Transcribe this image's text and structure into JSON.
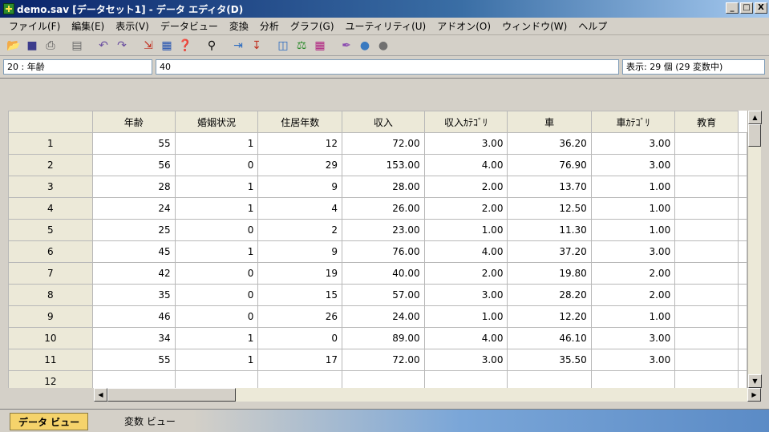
{
  "window": {
    "title": "demo.sav [データセット1] - データ エディタ(D)",
    "controls": [
      "_",
      "□",
      "X"
    ]
  },
  "menu": [
    "ファイル(F)",
    "編集(E)",
    "表示(V)",
    "データビュー",
    "変換",
    "分析",
    "グラフ(G)",
    "ユーティリティ(U)",
    "アドオン(O)",
    "ウィンドウ(W)",
    "ヘルプ"
  ],
  "toolbar_icons": [
    "open-icon",
    "save-icon",
    "print-icon",
    "dialog-recall-icon",
    "undo-icon",
    "redo-icon",
    "goto-case-icon",
    "goto-variable-icon",
    "variables-icon",
    "find-icon",
    "insert-cases-icon",
    "insert-variable-icon",
    "split-file-icon",
    "weight-cases-icon",
    "select-cases-icon",
    "value-labels-icon",
    "use-sets-icon",
    "show-all-icon"
  ],
  "cellbar": {
    "cell_ref": "20 : 年齢",
    "value": "40",
    "visible_info": "表示: 29 個 (29 変数中)"
  },
  "grid": {
    "columns": [
      "年齢",
      "婚姻状況",
      "住居年数",
      "収入",
      "収入ｶﾃｺﾞﾘ",
      "車",
      "車ｶﾃｺﾞﾘ",
      "教育"
    ],
    "rows": [
      {
        "num": "1",
        "cells": [
          "55",
          "1",
          "12",
          "72.00",
          "3.00",
          "36.20",
          "3.00",
          ""
        ]
      },
      {
        "num": "2",
        "cells": [
          "56",
          "0",
          "29",
          "153.00",
          "4.00",
          "76.90",
          "3.00",
          ""
        ]
      },
      {
        "num": "3",
        "cells": [
          "28",
          "1",
          "9",
          "28.00",
          "2.00",
          "13.70",
          "1.00",
          ""
        ]
      },
      {
        "num": "4",
        "cells": [
          "24",
          "1",
          "4",
          "26.00",
          "2.00",
          "12.50",
          "1.00",
          ""
        ]
      },
      {
        "num": "5",
        "cells": [
          "25",
          "0",
          "2",
          "23.00",
          "1.00",
          "11.30",
          "1.00",
          ""
        ]
      },
      {
        "num": "6",
        "cells": [
          "45",
          "1",
          "9",
          "76.00",
          "4.00",
          "37.20",
          "3.00",
          ""
        ]
      },
      {
        "num": "7",
        "cells": [
          "42",
          "0",
          "19",
          "40.00",
          "2.00",
          "19.80",
          "2.00",
          ""
        ]
      },
      {
        "num": "8",
        "cells": [
          "35",
          "0",
          "15",
          "57.00",
          "3.00",
          "28.20",
          "2.00",
          ""
        ]
      },
      {
        "num": "9",
        "cells": [
          "46",
          "0",
          "26",
          "24.00",
          "1.00",
          "12.20",
          "1.00",
          ""
        ]
      },
      {
        "num": "10",
        "cells": [
          "34",
          "1",
          "0",
          "89.00",
          "4.00",
          "46.10",
          "3.00",
          ""
        ]
      },
      {
        "num": "11",
        "cells": [
          "55",
          "1",
          "17",
          "72.00",
          "3.00",
          "35.50",
          "3.00",
          ""
        ]
      },
      {
        "num": "12",
        "cells": [
          "",
          "",
          "",
          "",
          "",
          "",
          "",
          ""
        ]
      }
    ]
  },
  "tabs": {
    "data_view": "データ ビュー",
    "variable_view": "変数 ビュー"
  },
  "colors": {
    "title_bar": "#0a246a",
    "chrome": "#d4d0c8",
    "active_tab": "#f5d36b",
    "tab_strip": "#5b8bc6"
  }
}
